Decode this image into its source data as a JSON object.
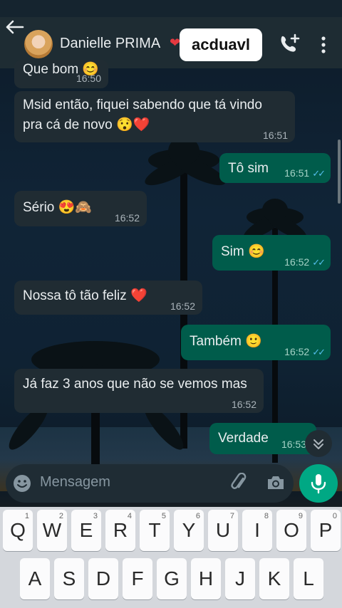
{
  "header": {
    "contact_name": "Danielle PRIMA",
    "heart": "❤",
    "sticker_text": "acduavl",
    "icons": [
      "back-arrow-icon",
      "avatar",
      "add-call-icon",
      "menu-dots-icon"
    ]
  },
  "messages": [
    {
      "dir": "in",
      "text": "Que bom 😊",
      "time": "16:50"
    },
    {
      "dir": "in",
      "line1": "Msid então, fiquei sabendo que tá vindo",
      "line2": "pra cá de novo 😯❤️",
      "time": "16:51"
    },
    {
      "dir": "out",
      "text": "Tô sim",
      "time": "16:51",
      "ticks": "✓✓"
    },
    {
      "dir": "in",
      "text": "Sério 😍🙈",
      "time": "16:52"
    },
    {
      "dir": "out",
      "text": "Sim 😊",
      "time": "16:52",
      "ticks": "✓✓"
    },
    {
      "dir": "in",
      "text": "Nossa tô tão feliz ❤️",
      "time": "16:52"
    },
    {
      "dir": "out",
      "text": "Também 🙂",
      "time": "16:52",
      "ticks": "✓✓"
    },
    {
      "dir": "in",
      "text": "Já faz 3 anos que não se vemos mas",
      "time": "16:52"
    },
    {
      "dir": "out",
      "text": "Verdade",
      "time": "16:53"
    }
  ],
  "composer": {
    "placeholder": "Mensagem",
    "icons": [
      "emoji-icon",
      "attach-clip-icon",
      "camera-icon",
      "microphone-icon"
    ]
  },
  "keyboard": {
    "row1": [
      {
        "key": "Q",
        "hint": "1"
      },
      {
        "key": "W",
        "hint": "2"
      },
      {
        "key": "E",
        "hint": "3"
      },
      {
        "key": "R",
        "hint": "4"
      },
      {
        "key": "T",
        "hint": "5"
      },
      {
        "key": "Y",
        "hint": "6"
      },
      {
        "key": "U",
        "hint": "7"
      },
      {
        "key": "I",
        "hint": "8"
      },
      {
        "key": "O",
        "hint": "9"
      },
      {
        "key": "P",
        "hint": "0"
      }
    ],
    "row2": [
      "A",
      "S",
      "D",
      "F",
      "G",
      "H",
      "J",
      "K",
      "L"
    ]
  },
  "colors": {
    "incoming_bubble": "#202c33",
    "outgoing_bubble": "#005c4b",
    "accent_green": "#00a884",
    "read_ticks": "#53bdeb"
  }
}
